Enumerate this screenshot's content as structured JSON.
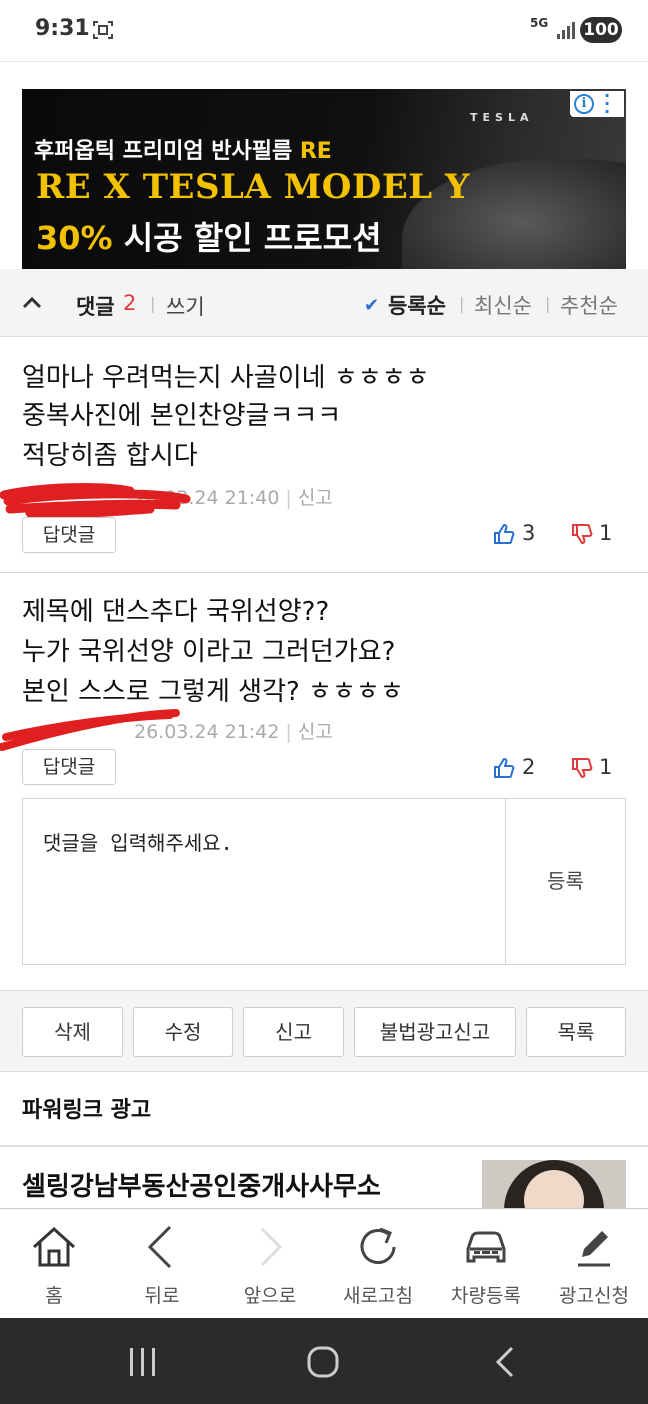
{
  "status_bar": {
    "time": "9:31",
    "network": "5G",
    "battery": "100"
  },
  "ad": {
    "brand": "TESLA",
    "line1_prefix": "후퍼옵틱 프리미엄 반사필름 ",
    "line1_highlight": "RE",
    "line2": "RE X TESLA MODEL Y",
    "line3_highlight": "30%",
    "line3_rest": " 시공 할인 프로모션",
    "info_icon": "info-icon",
    "menu_icon": "kebab-menu-icon"
  },
  "comments_bar": {
    "title": "댓글",
    "count": "2",
    "write_label": "쓰기",
    "sort_options": [
      "등록순",
      "최신순",
      "추천순"
    ],
    "selected_sort": "등록순"
  },
  "comments": [
    {
      "lines": [
        "얼마나 우려먹는지 사골이네 ㅎㅎㅎㅎ",
        "중복사진에 본인찬양글ㅋㅋㅋ",
        "적당히좀 합시다"
      ],
      "date": "26.03.24  21:40",
      "report": "신고",
      "reply_label": "답댓글",
      "likes": "3",
      "dislikes": "1"
    },
    {
      "lines": [
        "제목에 댄스추다 국위선양??",
        "누가 국위선양 이라고 그러던가요?",
        "본인 스스로 그렇게 생각? ㅎㅎㅎㅎ"
      ],
      "date": "26.03.24  21:42",
      "report": "신고",
      "reply_label": "답댓글",
      "likes": "2",
      "dislikes": "1"
    }
  ],
  "reply_form": {
    "placeholder": "댓글을 입력해주세요.",
    "submit_label": "등록"
  },
  "action_buttons": [
    "삭제",
    "수정",
    "신고",
    "불법광고신고",
    "목록"
  ],
  "powerlink": {
    "title": "파워링크 광고",
    "first_ad": "셀링강남부동산공인중개사사무소"
  },
  "bottom_nav": [
    {
      "label": "홈",
      "icon": "home-icon"
    },
    {
      "label": "뒤로",
      "icon": "back-icon"
    },
    {
      "label": "앞으로",
      "icon": "forward-icon"
    },
    {
      "label": "새로고침",
      "icon": "refresh-icon"
    },
    {
      "label": "차량등록",
      "icon": "car-icon"
    },
    {
      "label": "광고신청",
      "icon": "pen-icon"
    }
  ],
  "colors": {
    "accent_red": "#e03a3a",
    "accent_blue": "#2a6fd4",
    "ad_yellow": "#f2c200"
  }
}
